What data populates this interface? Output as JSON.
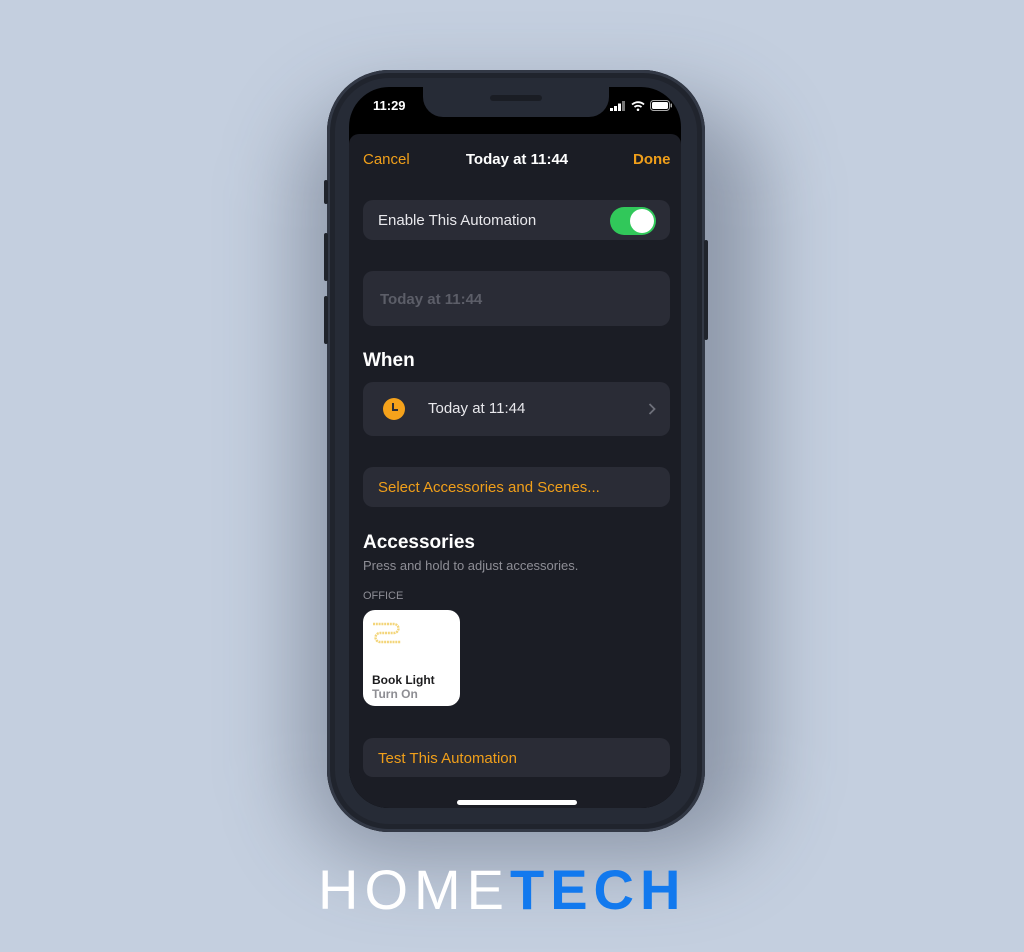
{
  "status_bar": {
    "time": "11:29",
    "icons": [
      "cellular-signal-icon",
      "wifi-icon",
      "battery-icon"
    ]
  },
  "nav": {
    "cancel_label": "Cancel",
    "title": "Today at 11:44",
    "done_label": "Done"
  },
  "enable_row": {
    "label": "Enable This Automation",
    "toggle_on": true
  },
  "name_field": {
    "placeholder": "Today at 11:44"
  },
  "when": {
    "heading": "When",
    "trigger_label": "Today at 11:44",
    "trigger_icon": "clock-icon"
  },
  "select_accessories_label": "Select Accessories and Scenes...",
  "accessories": {
    "heading": "Accessories",
    "hint": "Press and hold to adjust accessories.",
    "room": "OFFICE",
    "items": [
      {
        "name": "Book Light",
        "action": "Turn On",
        "icon": "light-strip-icon"
      }
    ]
  },
  "test_label": "Test This Automation",
  "logo": {
    "part1": "HOME",
    "part2": "TECH"
  },
  "colors": {
    "accent": "#f09f1a",
    "toggle_on": "#31c85a",
    "brand_blue": "#1279ee",
    "background": "#c4cfdf"
  }
}
